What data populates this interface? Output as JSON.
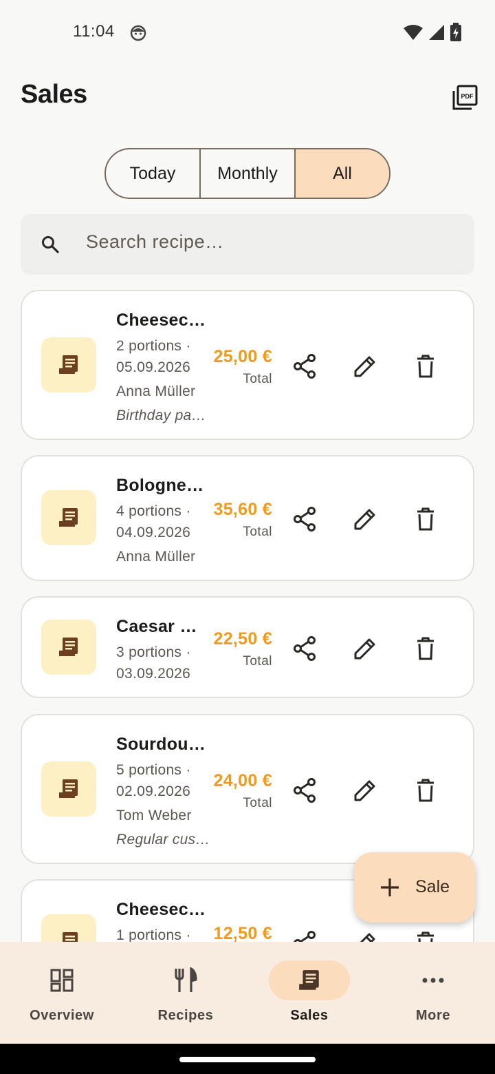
{
  "status_bar": {
    "time": "11:04",
    "icons": [
      "face-icon",
      "wifi-icon",
      "signal-icon",
      "battery-charging-icon"
    ]
  },
  "header": {
    "title": "Sales",
    "action_icon": "pdf-icon"
  },
  "filter": {
    "options": [
      "Today",
      "Monthly",
      "All"
    ],
    "selected": "All"
  },
  "search": {
    "placeholder": "Search recipe…",
    "icon": "search-icon"
  },
  "sales": [
    {
      "title": "Cheesec…",
      "portions": "2 portions ·",
      "date": "05.09.2026",
      "customer": "Anna Müller",
      "note": "Birthday pa…",
      "amount": "25,00 €",
      "total_label": "Total"
    },
    {
      "title": "Bologne…",
      "portions": "4 portions ·",
      "date": "04.09.2026",
      "customer": "Anna Müller",
      "note": "",
      "amount": "35,60 €",
      "total_label": "Total"
    },
    {
      "title": "Caesar …",
      "portions": "3 portions ·",
      "date": "03.09.2026",
      "customer": "",
      "note": "",
      "amount": "22,50 €",
      "total_label": "Total"
    },
    {
      "title": "Sourdou…",
      "portions": "5 portions ·",
      "date": "02.09.2026",
      "customer": "Tom Weber",
      "note": "Regular cus…",
      "amount": "24,00 €",
      "total_label": "Total"
    },
    {
      "title": "Cheesec…",
      "portions": "1 portions ·",
      "date": "",
      "customer": "",
      "note": "",
      "amount": "12,50 €",
      "total_label": ""
    }
  ],
  "fab": {
    "label": "Sale",
    "icon": "plus-icon"
  },
  "nav": [
    {
      "label": "Overview",
      "icon": "dashboard-icon"
    },
    {
      "label": "Recipes",
      "icon": "cutlery-icon"
    },
    {
      "label": "Sales",
      "icon": "receipt-icon",
      "active": true
    },
    {
      "label": "More",
      "icon": "more-icon"
    }
  ],
  "colors": {
    "accent": "#fbdcbc",
    "amount": "#f09a1e",
    "icon_bg": "#fdf0c4",
    "icon_fg": "#6b3f1f",
    "nav_bg": "#f8ebdf"
  }
}
